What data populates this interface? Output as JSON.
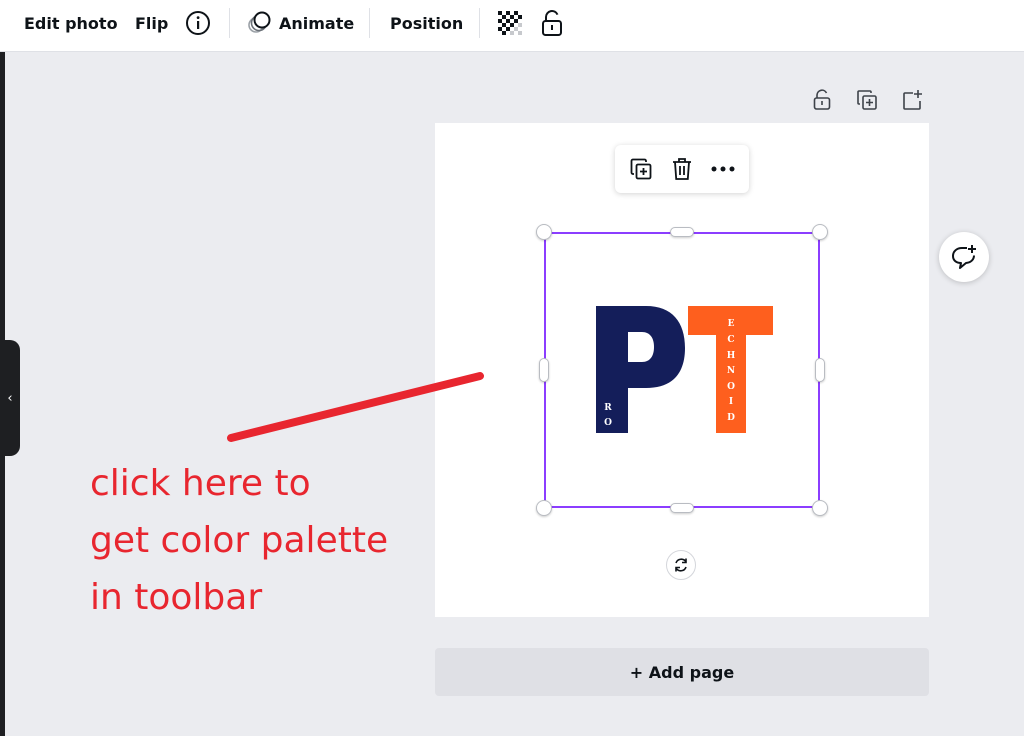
{
  "toolbar": {
    "edit_photo": "Edit photo",
    "flip": "Flip",
    "info_icon": "info-icon",
    "animate": "Animate",
    "position": "Position",
    "transparency_icon": "checkerboard-icon",
    "lock_icon": "lock-icon"
  },
  "page_actions": {
    "lock_icon": "lock-icon",
    "duplicate_icon": "duplicate-icon",
    "add_icon": "add-page-icon"
  },
  "element_menu": {
    "duplicate_icon": "duplicate-icon",
    "delete_icon": "trash-icon",
    "more_icon": "more-icon"
  },
  "logo": {
    "big_letter_1": "P",
    "big_letter_2": "T",
    "small_left": [
      "R",
      "O"
    ],
    "small_right": [
      "E",
      "C",
      "H",
      "N",
      "O",
      "I",
      "D"
    ]
  },
  "add_page": {
    "label": "+ Add page"
  },
  "annotation": {
    "lines": [
      "click here to",
      "get color palette",
      "in toolbar"
    ]
  },
  "colors": {
    "navy": "#141e5a",
    "orange": "#fe5f1e",
    "selection": "#8b3dff",
    "annotation": "#e8262f"
  }
}
